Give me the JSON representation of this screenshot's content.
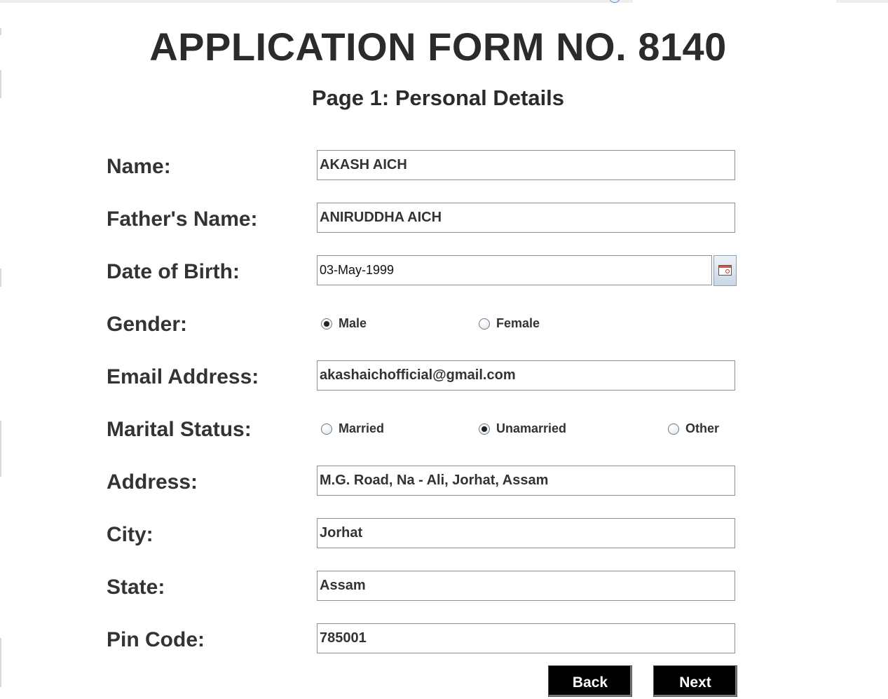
{
  "form": {
    "title": "APPLICATION FORM NO. 8140",
    "subtitle": "Page 1: Personal Details"
  },
  "fields": {
    "name": {
      "label": "Name:",
      "value": "AKASH AICH"
    },
    "father_name": {
      "label": "Father's Name:",
      "value": "ANIRUDDHA AICH"
    },
    "dob": {
      "label": "Date of Birth:",
      "value": "03-May-1999"
    },
    "gender": {
      "label": "Gender:",
      "options": [
        {
          "label": "Male",
          "selected": true
        },
        {
          "label": "Female",
          "selected": false
        }
      ]
    },
    "email": {
      "label": "Email Address:",
      "value": "akashaichofficial@gmail.com"
    },
    "marital_status": {
      "label": "Marital Status:",
      "options": [
        {
          "label": "Married",
          "selected": false
        },
        {
          "label": "Unamarried",
          "selected": true
        },
        {
          "label": "Other",
          "selected": false
        }
      ]
    },
    "address": {
      "label": "Address:",
      "value": "M.G. Road, Na - Ali, Jorhat, Assam"
    },
    "city": {
      "label": "City:",
      "value": "Jorhat"
    },
    "state": {
      "label": "State:",
      "value": "Assam"
    },
    "pin_code": {
      "label": "Pin Code:",
      "value": "785001"
    }
  },
  "buttons": {
    "back": "Back",
    "next": "Next"
  },
  "icons": {
    "calendar": "calendar-icon",
    "radio_selected": "radio-selected",
    "radio_unselected": "radio-unselected"
  }
}
